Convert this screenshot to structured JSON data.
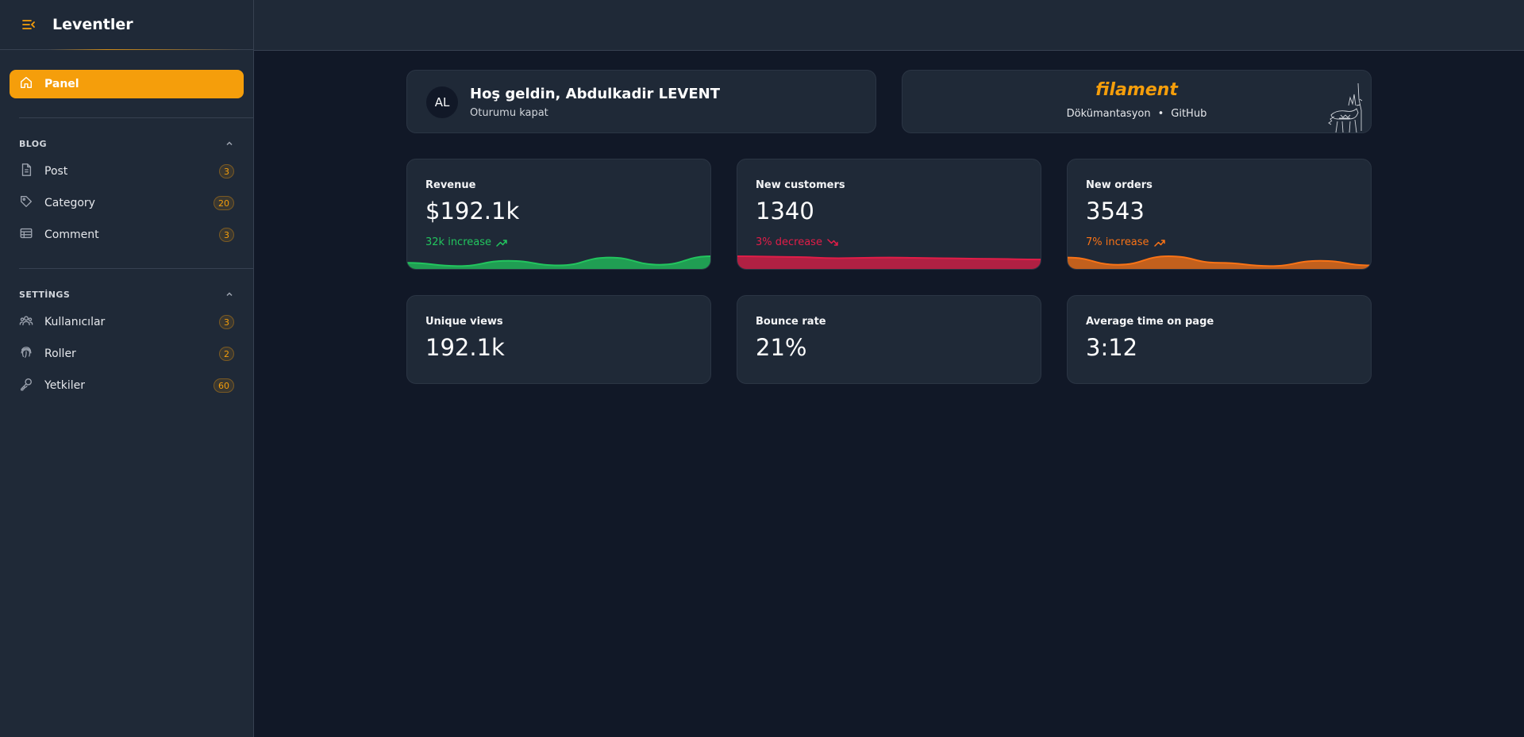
{
  "brand": {
    "title": "Leventler"
  },
  "sidebar": {
    "active": {
      "label": "Panel",
      "icon": "home-icon"
    },
    "groups": [
      {
        "label": "BLOG",
        "items": [
          {
            "label": "Post",
            "badge": "3",
            "icon": "document-icon"
          },
          {
            "label": "Category",
            "badge": "20",
            "icon": "tag-icon"
          },
          {
            "label": "Comment",
            "badge": "3",
            "icon": "table-icon"
          }
        ]
      },
      {
        "label": "SETTİNGS",
        "items": [
          {
            "label": "Kullanıcılar",
            "badge": "3",
            "icon": "users-icon"
          },
          {
            "label": "Roller",
            "badge": "2",
            "icon": "fingerprint-icon"
          },
          {
            "label": "Yetkiler",
            "badge": "60",
            "icon": "key-icon"
          }
        ]
      }
    ]
  },
  "account": {
    "initials": "AL",
    "welcome": "Hoş geldin, Abdulkadir LEVENT",
    "logout": "Oturumu kapat"
  },
  "filament": {
    "logo": "filament",
    "docs": "Dökümantasyon",
    "separator": "•",
    "github": "GitHub"
  },
  "stats": [
    {
      "label": "Revenue",
      "value": "$192.1k",
      "description": "32k increase",
      "trend": "up",
      "color": "#22c55e",
      "chart": [
        7,
        2,
        10,
        3,
        15,
        4,
        17
      ]
    },
    {
      "label": "New customers",
      "value": "1340",
      "description": "3% decrease",
      "trend": "down",
      "color": "#e11d48",
      "chart": [
        17,
        16,
        14,
        15,
        14,
        13,
        12
      ]
    },
    {
      "label": "New orders",
      "value": "3543",
      "description": "7% increase",
      "trend": "up",
      "color": "#f97316",
      "chart": [
        15,
        4,
        17,
        7,
        2,
        10,
        3
      ]
    },
    {
      "label": "Unique views",
      "value": "192.1k"
    },
    {
      "label": "Bounce rate",
      "value": "21%"
    },
    {
      "label": "Average time on page",
      "value": "3:12"
    }
  ],
  "colors": {
    "accent": "#f59e0b",
    "background": "#111827",
    "surface": "#1f2937"
  }
}
